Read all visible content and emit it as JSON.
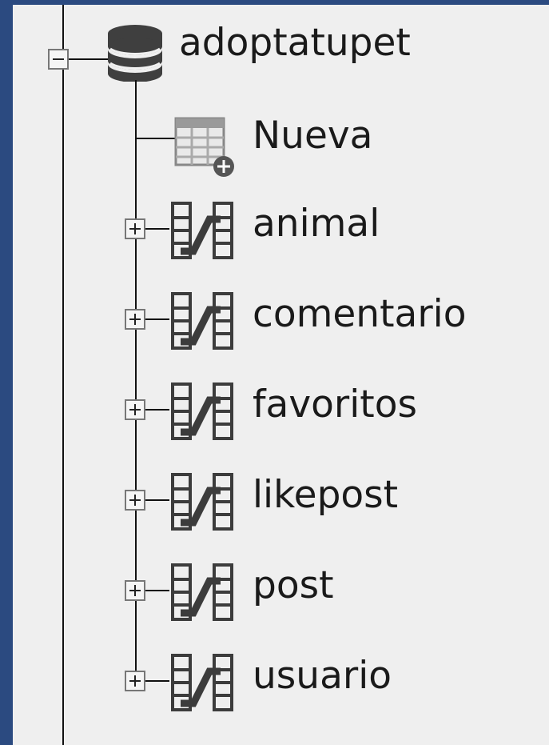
{
  "tree": {
    "database": {
      "name": "adoptatupet",
      "icon": "database-icon",
      "expanded": true
    },
    "new_item": {
      "label": "Nueva",
      "icon": "new-table-icon"
    },
    "tables": [
      {
        "label": "animal",
        "icon": "table-relation-icon",
        "expanded": false
      },
      {
        "label": "comentario",
        "icon": "table-relation-icon",
        "expanded": false
      },
      {
        "label": "favoritos",
        "icon": "table-relation-icon",
        "expanded": false
      },
      {
        "label": "likepost",
        "icon": "table-relation-icon",
        "expanded": false
      },
      {
        "label": "post",
        "icon": "table-relation-icon",
        "expanded": false
      },
      {
        "label": "usuario",
        "icon": "table-relation-icon",
        "expanded": false
      }
    ]
  },
  "colors": {
    "window_border": "#2b4a80",
    "panel_bg": "#efefef",
    "tree_line": "#111111",
    "text": "#1a1a1a"
  }
}
